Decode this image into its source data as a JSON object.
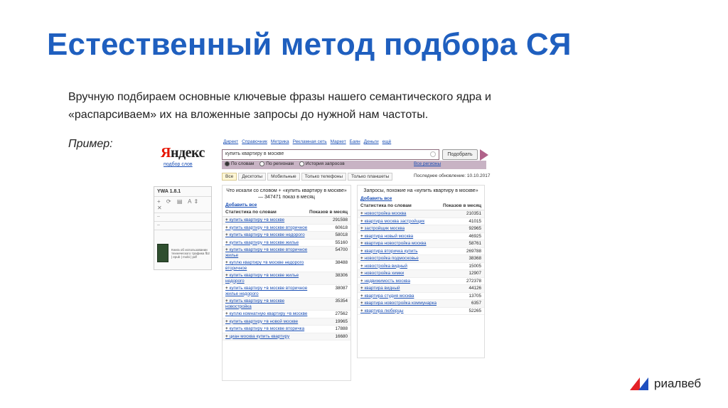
{
  "slide": {
    "title": "Естественный метод подбора СЯ",
    "body": "Вручную подбираем основные ключевые фразы нашего семантического ядра и «распарсиваем» их на вложенные запросы до нужной нам частоты.",
    "example_label": "Пример:"
  },
  "yandex": {
    "logo": "Яндекс",
    "subtitle": "подбор слов",
    "topnav": [
      "Директ",
      "Справочник",
      "Метрика",
      "Рекламная сеть",
      "Маркет",
      "Баян",
      "Деньги",
      "ещё"
    ],
    "search_value": "купить квартиру в москве",
    "search_button": "Подобрать",
    "radios": [
      "По словам",
      "По регионам",
      "История запросов"
    ],
    "regions_link": "Все регионы",
    "tabs": [
      "Все",
      "Десктопы",
      "Мобильные",
      "Только телефоны",
      "Только планшеты"
    ],
    "updated": "Последнее обновление: 10.10.2017"
  },
  "ywa": {
    "title": "YWA 1.8.1",
    "icons": "+ ⟳ ▤ A⇕ ✕",
    "dash1": "–",
    "dash2": "–",
    "book_text": "Книга об использовании технического трафика fb2 | epub | mobi | pdf"
  },
  "left_panel": {
    "head": "Что искали со словом + «купить квартиру в москве» — 347471 показ в месяц",
    "add_all": "Добавить все",
    "col1": "Статистика по словам",
    "col2": "Показов в месяц",
    "rows": [
      {
        "phrase": "купить квартиру +в москве",
        "count": "291598"
      },
      {
        "phrase": "купить квартиру +в москве вторичное",
        "count": "60618"
      },
      {
        "phrase": "купить квартиру +в москве недорого",
        "count": "58018"
      },
      {
        "phrase": "купить квартиру +в москве жилье",
        "count": "55160"
      },
      {
        "phrase": "купить квартиру +в москве вторичное жилье",
        "count": "54700"
      },
      {
        "phrase": "куплю квартиру +в москве недорого вторичное",
        "count": "38488"
      },
      {
        "phrase": "купить квартиру +в москве жилье недорого",
        "count": "38306"
      },
      {
        "phrase": "купить квартиру +в москве вторичное жилье недорого",
        "count": "38087"
      },
      {
        "phrase": "купить квартиру +в москве новостройка",
        "count": "35354"
      },
      {
        "phrase": "куплю комнатную квартиру +в москве",
        "count": "27562"
      },
      {
        "phrase": "купить квартиру +в новой москве",
        "count": "19965"
      },
      {
        "phrase": "купить квартиру +в москве вторичка",
        "count": "17888"
      },
      {
        "phrase": "циан москва купить квартиру",
        "count": "16680"
      }
    ]
  },
  "right_panel": {
    "head": "Запросы, похожие на «купить квартиру в москве»",
    "add_all": "Добавить все",
    "col1": "Статистика по словам",
    "col2": "Показов в месяц",
    "rows": [
      {
        "phrase": "новостройка москва",
        "count": "210351"
      },
      {
        "phrase": "квартира москва застройщик",
        "count": "41015"
      },
      {
        "phrase": "застройщик москва",
        "count": "92965"
      },
      {
        "phrase": "квартира новый москва",
        "count": "46925"
      },
      {
        "phrase": "квартира новостройка москва",
        "count": "58761"
      },
      {
        "phrase": "квартира вторичка купить",
        "count": "269788"
      },
      {
        "phrase": "новостройка подмосковье",
        "count": "38368"
      },
      {
        "phrase": "новостройка видный",
        "count": "15005"
      },
      {
        "phrase": "новостройка химки",
        "count": "12907"
      },
      {
        "phrase": "недвижимость москва",
        "count": "272378"
      },
      {
        "phrase": "квартира видный",
        "count": "44126"
      },
      {
        "phrase": "квартира студия москва",
        "count": "13705"
      },
      {
        "phrase": "квартира новостройка коммунарка",
        "count": "6357"
      },
      {
        "phrase": "квартира люберцы",
        "count": "52265"
      }
    ]
  },
  "brand": {
    "name": "риалвеб",
    "colors": {
      "red": "#e32026",
      "blue": "#1f4fbf"
    }
  }
}
